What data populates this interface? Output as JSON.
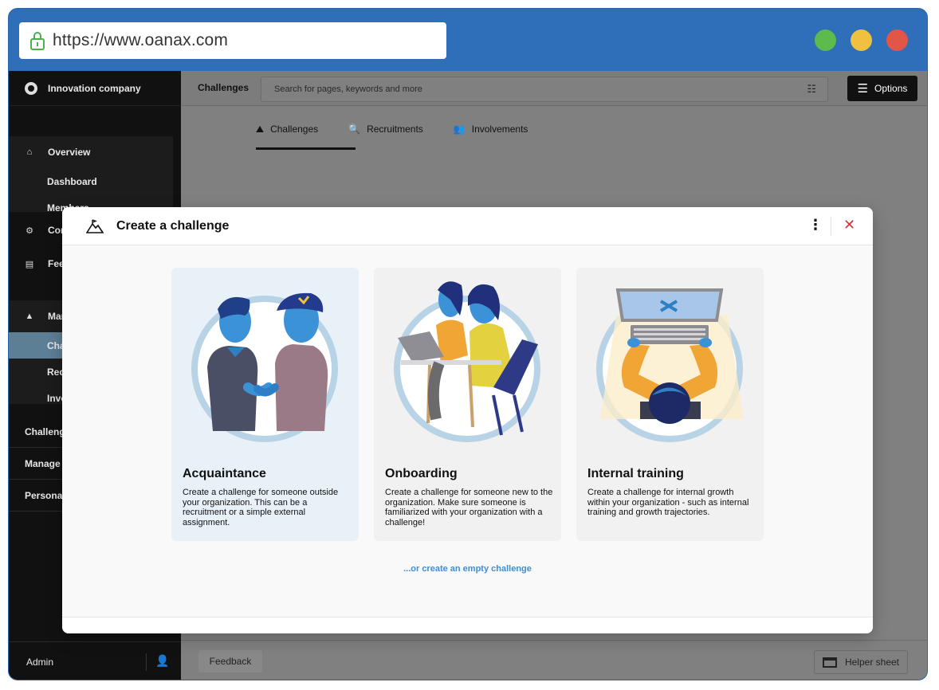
{
  "browser": {
    "url": "https://www.oanax.com",
    "dot_colors": [
      "#5dba4c",
      "#f0c040",
      "#e25647"
    ]
  },
  "sidebar": {
    "org_name": "Innovation company",
    "items": [
      {
        "label": "Overview",
        "icon": "home-icon"
      },
      {
        "label": "Dashboard"
      },
      {
        "label": "Members"
      },
      {
        "label": "Connections",
        "icon": "compass-icon"
      },
      {
        "label": "Feedback",
        "icon": "document-icon"
      },
      {
        "label": "Manage",
        "icon": "mountain-icon"
      },
      {
        "label": "Challenges"
      },
      {
        "label": "Recruitments"
      },
      {
        "label": "Involvements"
      }
    ],
    "plain_items": [
      "Challenges",
      "Manage c",
      "Personal"
    ],
    "admin_label": "Admin"
  },
  "topbar": {
    "title": "Challenges",
    "search_placeholder": "Search for pages, keywords and more",
    "options_label": "Options"
  },
  "tabs": [
    {
      "label": "Challenges",
      "icon": "mountain-icon"
    },
    {
      "label": "Recruitments",
      "icon": "search-person-icon"
    },
    {
      "label": "Involvements",
      "icon": "people-icon"
    }
  ],
  "footer": {
    "feedback_label": "Feedback",
    "helper_label": "Helper sheet"
  },
  "modal": {
    "title": "Create a challenge",
    "cards": [
      {
        "title": "Acquaintance",
        "description": "Create a challenge for someone outside your organization. This can be a recruitment or a simple external assignment."
      },
      {
        "title": "Onboarding",
        "description": "Create a challenge for someone new to the organization. Make sure someone is familiarized with your organization with a challenge!"
      },
      {
        "title": "Internal training",
        "description": "Create a challenge for internal growth within your organization - such as internal training and growth trajectories."
      }
    ],
    "empty_link": "...or create an empty challenge"
  }
}
